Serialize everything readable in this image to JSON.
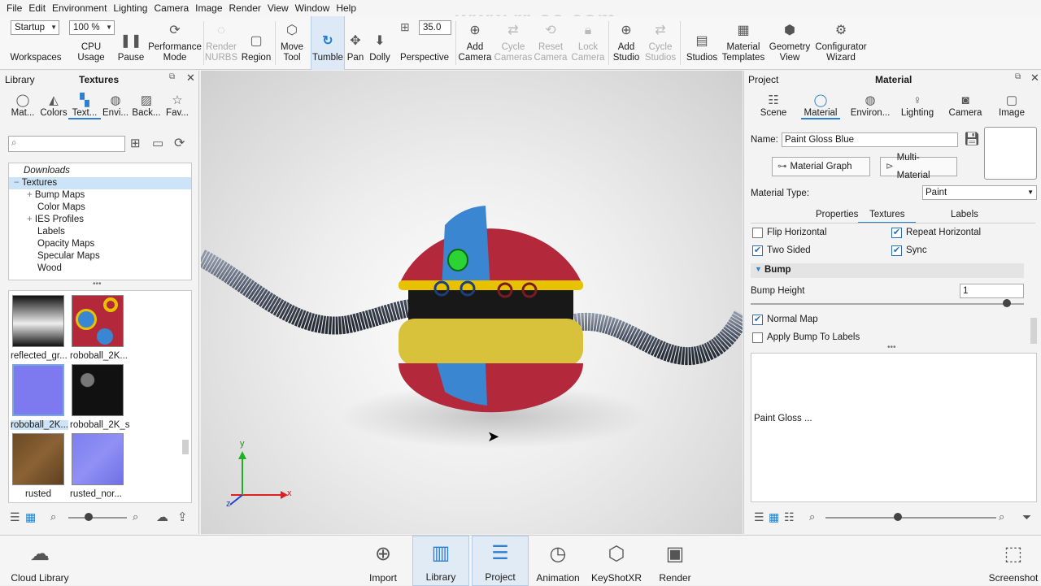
{
  "menu": [
    "File",
    "Edit",
    "Environment",
    "Lighting",
    "Camera",
    "Image",
    "Render",
    "View",
    "Window",
    "Help"
  ],
  "toolbar": {
    "workspace_value": "Startup",
    "workspaces_label": "Workspaces",
    "cpu_value": "100 %",
    "cpu_label": "CPU Usage",
    "pause_label": "Pause",
    "perf_label": "Performance\nMode",
    "render_nurbs_label": "Render\nNURBS",
    "region_label": "Region",
    "move_tool_label": "Move\nTool",
    "tumble_label": "Tumble",
    "pan_label": "Pan",
    "dolly_label": "Dolly",
    "fov_value": "35.0",
    "perspective_label": "Perspective",
    "add_camera_label": "Add\nCamera",
    "cycle_cameras_label": "Cycle\nCameras",
    "reset_camera_label": "Reset\nCamera",
    "lock_camera_label": "Lock\nCamera",
    "add_studio_label": "Add\nStudio",
    "cycle_studios_label": "Cycle\nStudios",
    "studios_label": "Studios",
    "material_templates_label": "Material\nTemplates",
    "geometry_view_label": "Geometry\nView",
    "configurator_wizard_label": "Configurator\nWizard"
  },
  "watermark": "www.rr-sc.com",
  "library": {
    "title_left": "Library",
    "title": "Textures",
    "tabs": [
      "Mat...",
      "Colors",
      "Text...",
      "Envi...",
      "Back...",
      "Fav..."
    ],
    "tree": [
      "Downloads",
      "Textures",
      "Bump Maps",
      "Color Maps",
      "IES Profiles",
      "Labels",
      "Opacity Maps",
      "Specular Maps",
      "Wood"
    ],
    "thumbs": [
      "reflected_gr...",
      "roboball_2K...",
      "roboball_2K...",
      "roboball_2K_s",
      "rusted",
      "rusted_nor..."
    ]
  },
  "project": {
    "title_left": "Project",
    "title": "Material",
    "tabs": [
      "Scene",
      "Material",
      "Environ...",
      "Lighting",
      "Camera",
      "Image"
    ],
    "name_label": "Name:",
    "name_value": "Paint Gloss Blue",
    "material_graph": "Material Graph",
    "multi_material": "Multi-Material",
    "material_type_label": "Material Type:",
    "material_type_value": "Paint",
    "subtabs": [
      "Properties",
      "Textures",
      "Labels"
    ],
    "flip_horizontal": "Flip Horizontal",
    "repeat_horizontal": "Repeat Horizontal",
    "two_sided": "Two Sided",
    "sync": "Sync",
    "bump_section": "Bump",
    "bump_height_label": "Bump Height",
    "bump_height_value": "1",
    "normal_map": "Normal Map",
    "apply_bump": "Apply Bump To Labels",
    "preview_label": "Paint Gloss ..."
  },
  "axis": {
    "x": "x",
    "y": "y",
    "z": "z"
  },
  "bottom": {
    "cloud_library": "Cloud Library",
    "import": "Import",
    "library": "Library",
    "project": "Project",
    "animation": "Animation",
    "keyshotxr": "KeyShotXR",
    "render": "Render",
    "screenshot": "Screenshot"
  },
  "colors": {
    "accent": "#2d7fd0",
    "ball_red": "#b3283a",
    "ball_blue": "#3a86d0",
    "ball_yellow": "#e8c200"
  }
}
